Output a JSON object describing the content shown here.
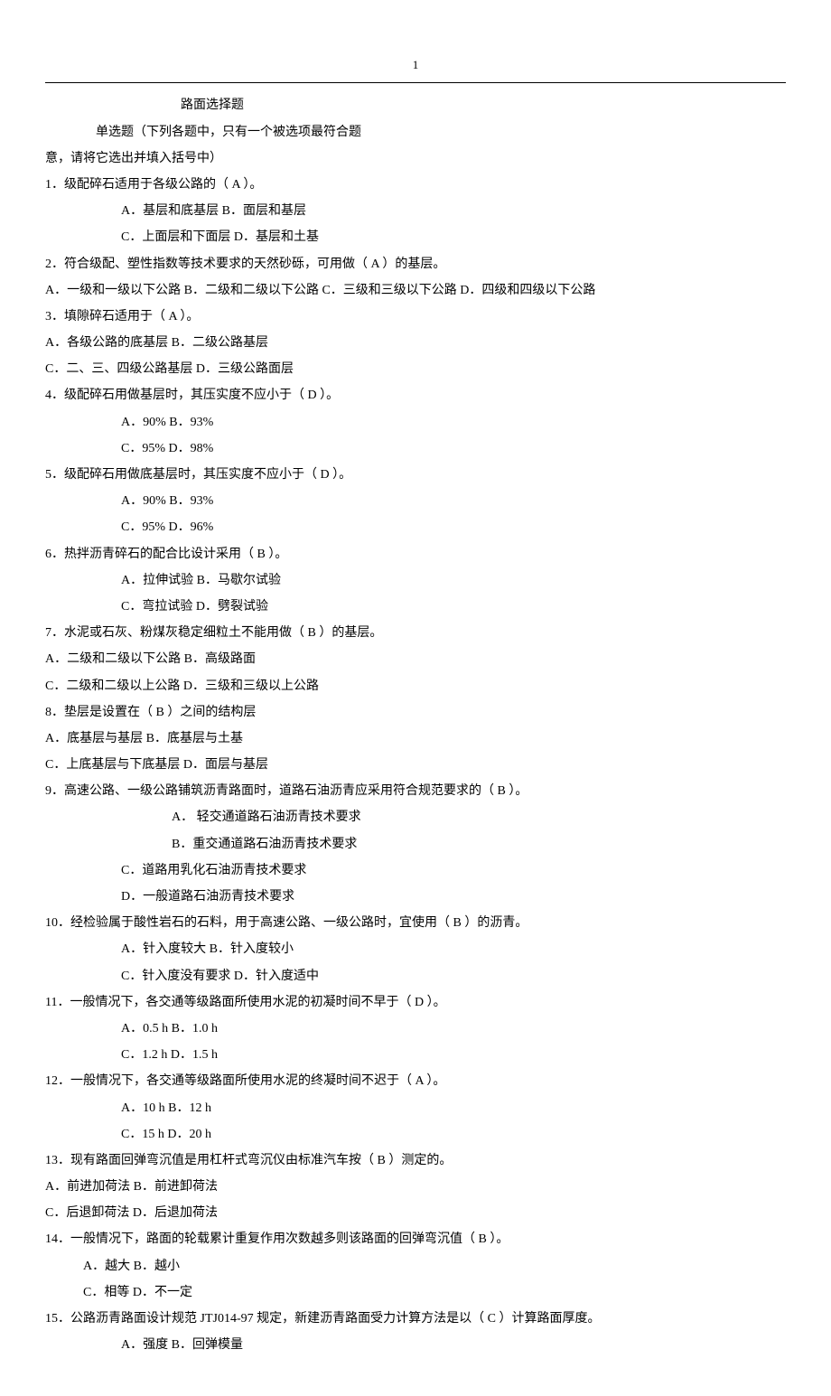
{
  "pageNumber": "1",
  "title": "路面选择题",
  "instruction1": "单选题（下列各题中，只有一个被选项最符合题",
  "instruction2": "意，请将它选出并填入括号中）",
  "q1": {
    "text": "1．级配碎石适用于各级公路的（  A  ）。",
    "opts1": "A．基层和底基层        B．面层和基层",
    "opts2": "C．上面层和下面层      D．基层和土基"
  },
  "q2": {
    "text": "2．符合级配、塑性指数等技术要求的天然砂砾，可用做（ A  ）的基层。",
    "opts": "A．一级和一级以下公路      B．二级和二级以下公路    C．三级和三级以下公路    D．四级和四级以下公路"
  },
  "q3": {
    "text": "3．填隙碎石适用于（  A  ）。",
    "opts1": "A．各级公路的底基层      B．二级公路基层",
    "opts2": "C．二、三、四级公路基层   D．三级公路面层"
  },
  "q4": {
    "text": "4．级配碎石用做基层时，其压实度不应小于（ D ）。",
    "opts1": "A．90%      B．93%",
    "opts2": "C．95%      D．98%"
  },
  "q5": {
    "text": "5．级配碎石用做底基层时，其压实度不应小于（ D ）。",
    "opts1": "A．90%    B．93%",
    "opts2": "C．95%    D．96%"
  },
  "q6": {
    "text": "6．热拌沥青碎石的配合比设计采用（ B  ）。",
    "opts1": "A．拉伸试验    B．马歇尔试验",
    "opts2": "C．弯拉试验    D．劈裂试验"
  },
  "q7": {
    "text": "7．水泥或石灰、粉煤灰稳定细粒土不能用做（ B  ）的基层。",
    "opts1": "A．二级和二级以下公路    B．高级路面",
    "opts2": "C．二级和二级以上公路    D．三级和三级以上公路"
  },
  "q8": {
    "text": "8．垫层是设置在（ B ）之间的结构层",
    "opts1": "A．底基层与基层              B．底基层与土基",
    "opts2": "C．上底基层与下底基层        D．面层与基层"
  },
  "q9": {
    "text": "9．高速公路、一级公路铺筑沥青路面时，道路石油沥青应采用符合规范要求的（ B ）。",
    "opts1": "A．      轻交通道路石油沥青技术要求",
    "opts2": "B．重交通道路石油沥青技术要求",
    "opts3": "C．道路用乳化石油沥青技术要求",
    "opts4": "D．一般道路石油沥青技术要求"
  },
  "q10": {
    "text": "10．经检验属于酸性岩石的石料，用于高速公路、一级公路时，宜使用（ B ）的沥青。",
    "opts1": "A．针入度较大        B．针入度较小",
    "opts2": "C．针入度没有要求    D．针入度适中"
  },
  "q11": {
    "text": "11．一般情况下，各交通等级路面所使用水泥的初凝时间不早于（ D ）。",
    "opts1": "A．0.5 h      B．1.0 h",
    "opts2": "C．1.2 h      D．1.5 h"
  },
  "q12": {
    "text": "12．一般情况下，各交通等级路面所使用水泥的终凝时间不迟于（ A ）。",
    "opts1": "A．10 h     B．12 h",
    "opts2": "C．15 h     D．20 h"
  },
  "q13": {
    "text": "13．现有路面回弹弯沉值是用杠杆式弯沉仪由标准汽车按（ B ）测定的。",
    "opts1": "A．前进加荷法            B．前进卸荷法",
    "opts2": "C．后退卸荷法            D．后退加荷法"
  },
  "q14": {
    "text": "14．一般情况下，路面的轮载累计重复作用次数越多则该路面的回弹弯沉值（ B ）。",
    "opts1": "A．越大         B．越小",
    "opts2": "C．相等         D．不一定"
  },
  "q15": {
    "text": "15．公路沥青路面设计规范 JTJ014-97 规定，新建沥青路面受力计算方法是以（ C ）计算路面厚度。",
    "opts1": "A．强度         B．回弹模量"
  }
}
